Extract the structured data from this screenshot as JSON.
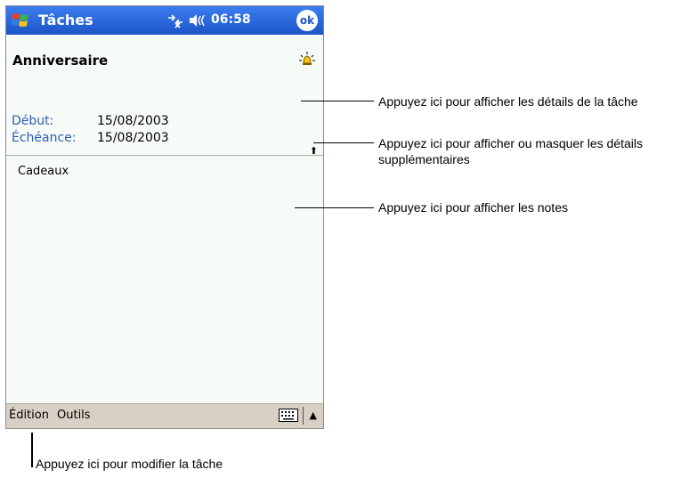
{
  "titlebar": {
    "app_title": "Tâches",
    "time": "06:58",
    "ok_label": "ok",
    "icons": [
      "windows-start-icon",
      "connectivity-icon",
      "volume-icon"
    ]
  },
  "task": {
    "title": "Anniversaire",
    "start_label": "Début:",
    "start_value": "15/08/2003",
    "due_label": "Échéance:",
    "due_value": "15/08/2003",
    "notes": "Cadeaux"
  },
  "menubar": {
    "edit_label": "Édition",
    "tools_label": "Outils"
  },
  "callouts": {
    "details": "Appuyez ici pour afficher les détails de la tâche",
    "toggle_line1": "Appuyez ici pour afficher ou masquer les détails",
    "toggle_line2": "supplémentaires",
    "notes": "Appuyez ici pour afficher les notes",
    "edit": "Appuyez ici pour modifier la tâche"
  },
  "colors": {
    "titlebar": "#1c55c8",
    "menubar": "#d8d0c4",
    "label_blue": "#2a5db0"
  }
}
